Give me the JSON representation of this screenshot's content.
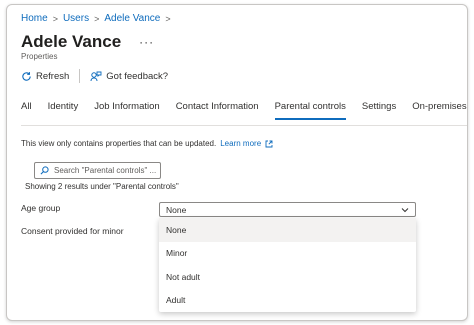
{
  "breadcrumb": {
    "home": "Home",
    "users": "Users",
    "user": "Adele Vance"
  },
  "header": {
    "title": "Adele Vance",
    "more": "···",
    "subtitle": "Properties"
  },
  "toolbar": {
    "refresh_label": "Refresh",
    "feedback_label": "Got feedback?"
  },
  "tabs": [
    {
      "label": "All"
    },
    {
      "label": "Identity"
    },
    {
      "label": "Job Information"
    },
    {
      "label": "Contact Information"
    },
    {
      "label": "Parental controls",
      "active": true
    },
    {
      "label": "Settings"
    },
    {
      "label": "On-premises"
    }
  ],
  "info": {
    "text": "This view only contains properties that can be updated.",
    "link": "Learn more"
  },
  "search": {
    "placeholder": "Search \"Parental controls\" ..."
  },
  "results": {
    "text": "Showing 2 results under \"Parental controls\""
  },
  "fields": {
    "age_group_label": "Age group",
    "age_group_value": "None",
    "consent_label": "Consent provided for minor"
  },
  "dropdown": {
    "options": [
      "None",
      "Minor",
      "Not adult",
      "Adult"
    ]
  },
  "colors": {
    "accent": "#0f6cbd",
    "text": "#323130",
    "muted": "#605e5c",
    "border": "#8a8886"
  },
  "icons": {
    "refresh": "refresh-icon",
    "feedback": "feedback-icon",
    "search": "search-icon",
    "external": "external-link-icon",
    "chevron": "chevron-down-icon"
  }
}
